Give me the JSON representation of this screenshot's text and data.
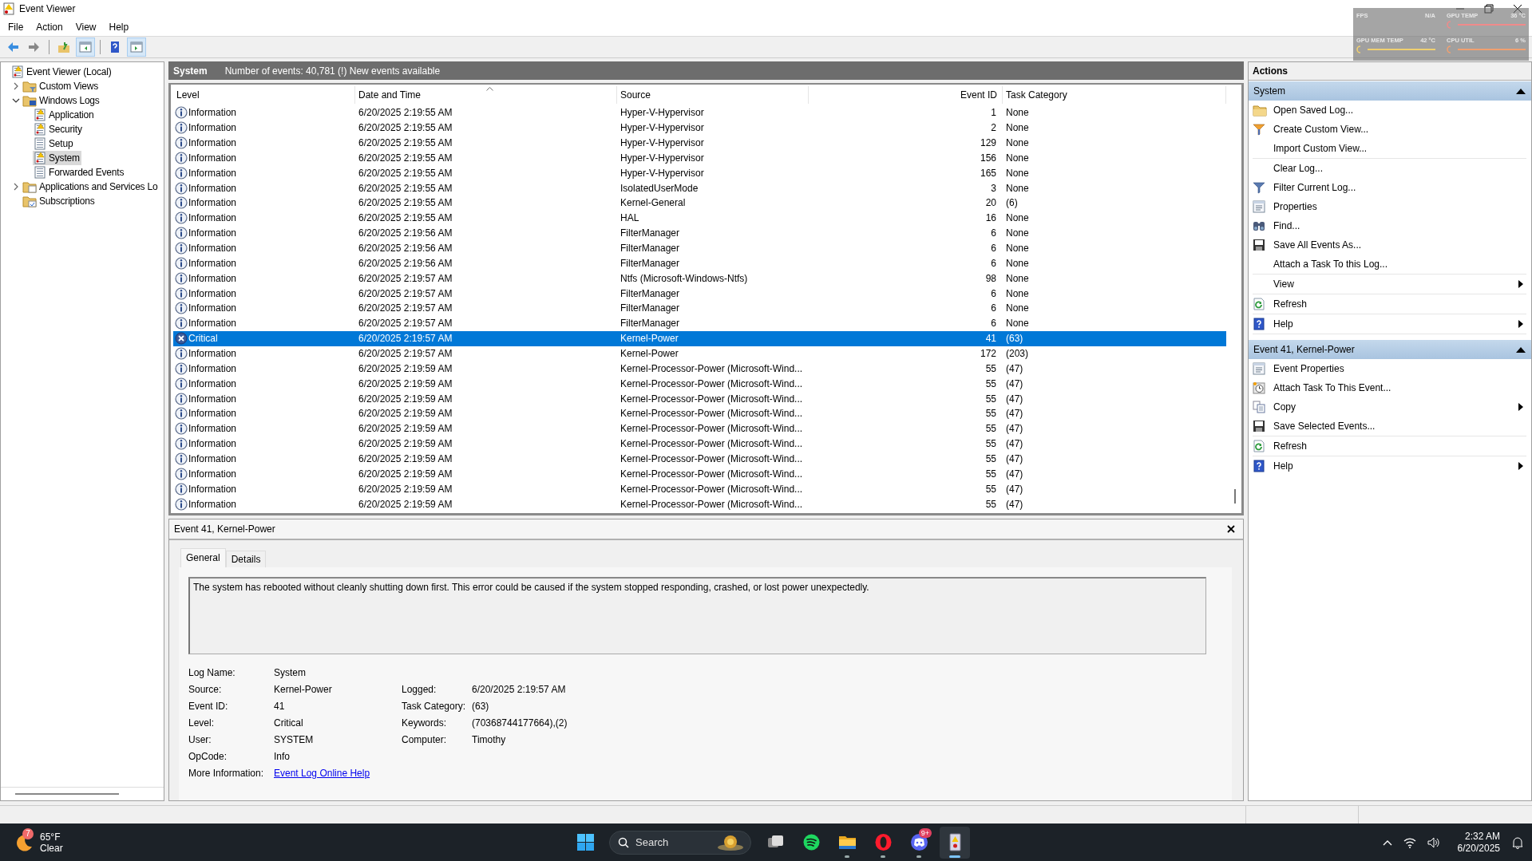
{
  "window": {
    "title": "Event Viewer"
  },
  "menu": [
    "File",
    "Action",
    "View",
    "Help"
  ],
  "toolbar": [
    {
      "kind": "back",
      "on": false
    },
    {
      "kind": "forward",
      "on": false
    },
    {
      "kind": "up",
      "on": false
    },
    {
      "kind": "show-tree",
      "on": true
    },
    {
      "kind": "help",
      "on": false
    },
    {
      "kind": "show-actions",
      "on": true
    }
  ],
  "tree": {
    "items": [
      {
        "label": "Event Viewer (Local)",
        "kind": "root",
        "selected": false,
        "children": [
          {
            "label": "Custom Views",
            "kind": "folder-filter",
            "expanded": false,
            "selected": false
          },
          {
            "label": "Windows Logs",
            "kind": "folder-pc",
            "expanded": true,
            "selected": false,
            "children": [
              {
                "label": "Application",
                "kind": "log-warn",
                "selected": false
              },
              {
                "label": "Security",
                "kind": "log-warn",
                "selected": false
              },
              {
                "label": "Setup",
                "kind": "log",
                "selected": false
              },
              {
                "label": "System",
                "kind": "log-warn",
                "selected": true
              },
              {
                "label": "Forwarded Events",
                "kind": "log",
                "selected": false
              }
            ]
          },
          {
            "label": "Applications and Services Lo",
            "kind": "folder-doc",
            "expanded": false,
            "selected": false
          },
          {
            "label": "Subscriptions",
            "kind": "subscriptions",
            "selected": false
          }
        ]
      }
    ]
  },
  "log_header": {
    "title": "System",
    "summary": "Number of events: 40,781 (!) New events available"
  },
  "table": {
    "columns": [
      {
        "label": "Level",
        "sorted": false
      },
      {
        "label": "Date and Time",
        "sorted": true
      },
      {
        "label": "Source",
        "sorted": false
      },
      {
        "label": "Event ID",
        "sorted": false
      },
      {
        "label": "Task Category",
        "sorted": false
      }
    ],
    "rows": [
      {
        "kind": "info",
        "level": "Information",
        "date": "6/20/2025 2:19:55 AM",
        "source": "Hyper-V-Hypervisor",
        "event_id": "1",
        "category": "None",
        "selected": false
      },
      {
        "kind": "info",
        "level": "Information",
        "date": "6/20/2025 2:19:55 AM",
        "source": "Hyper-V-Hypervisor",
        "event_id": "2",
        "category": "None",
        "selected": false
      },
      {
        "kind": "info",
        "level": "Information",
        "date": "6/20/2025 2:19:55 AM",
        "source": "Hyper-V-Hypervisor",
        "event_id": "129",
        "category": "None",
        "selected": false
      },
      {
        "kind": "info",
        "level": "Information",
        "date": "6/20/2025 2:19:55 AM",
        "source": "Hyper-V-Hypervisor",
        "event_id": "156",
        "category": "None",
        "selected": false
      },
      {
        "kind": "info",
        "level": "Information",
        "date": "6/20/2025 2:19:55 AM",
        "source": "Hyper-V-Hypervisor",
        "event_id": "165",
        "category": "None",
        "selected": false
      },
      {
        "kind": "info",
        "level": "Information",
        "date": "6/20/2025 2:19:55 AM",
        "source": "IsolatedUserMode",
        "event_id": "3",
        "category": "None",
        "selected": false
      },
      {
        "kind": "info",
        "level": "Information",
        "date": "6/20/2025 2:19:55 AM",
        "source": "Kernel-General",
        "event_id": "20",
        "category": "(6)",
        "selected": false
      },
      {
        "kind": "info",
        "level": "Information",
        "date": "6/20/2025 2:19:55 AM",
        "source": "HAL",
        "event_id": "16",
        "category": "None",
        "selected": false
      },
      {
        "kind": "info",
        "level": "Information",
        "date": "6/20/2025 2:19:56 AM",
        "source": "FilterManager",
        "event_id": "6",
        "category": "None",
        "selected": false
      },
      {
        "kind": "info",
        "level": "Information",
        "date": "6/20/2025 2:19:56 AM",
        "source": "FilterManager",
        "event_id": "6",
        "category": "None",
        "selected": false
      },
      {
        "kind": "info",
        "level": "Information",
        "date": "6/20/2025 2:19:56 AM",
        "source": "FilterManager",
        "event_id": "6",
        "category": "None",
        "selected": false
      },
      {
        "kind": "info",
        "level": "Information",
        "date": "6/20/2025 2:19:57 AM",
        "source": "Ntfs (Microsoft-Windows-Ntfs)",
        "event_id": "98",
        "category": "None",
        "selected": false
      },
      {
        "kind": "info",
        "level": "Information",
        "date": "6/20/2025 2:19:57 AM",
        "source": "FilterManager",
        "event_id": "6",
        "category": "None",
        "selected": false
      },
      {
        "kind": "info",
        "level": "Information",
        "date": "6/20/2025 2:19:57 AM",
        "source": "FilterManager",
        "event_id": "6",
        "category": "None",
        "selected": false
      },
      {
        "kind": "info",
        "level": "Information",
        "date": "6/20/2025 2:19:57 AM",
        "source": "FilterManager",
        "event_id": "6",
        "category": "None",
        "selected": false
      },
      {
        "kind": "critical",
        "level": "Critical",
        "date": "6/20/2025 2:19:57 AM",
        "source": "Kernel-Power",
        "event_id": "41",
        "category": "(63)",
        "selected": true
      },
      {
        "kind": "info",
        "level": "Information",
        "date": "6/20/2025 2:19:57 AM",
        "source": "Kernel-Power",
        "event_id": "172",
        "category": "(203)",
        "selected": false
      },
      {
        "kind": "info",
        "level": "Information",
        "date": "6/20/2025 2:19:59 AM",
        "source": "Kernel-Processor-Power (Microsoft-Wind...",
        "event_id": "55",
        "category": "(47)",
        "selected": false
      },
      {
        "kind": "info",
        "level": "Information",
        "date": "6/20/2025 2:19:59 AM",
        "source": "Kernel-Processor-Power (Microsoft-Wind...",
        "event_id": "55",
        "category": "(47)",
        "selected": false
      },
      {
        "kind": "info",
        "level": "Information",
        "date": "6/20/2025 2:19:59 AM",
        "source": "Kernel-Processor-Power (Microsoft-Wind...",
        "event_id": "55",
        "category": "(47)",
        "selected": false
      },
      {
        "kind": "info",
        "level": "Information",
        "date": "6/20/2025 2:19:59 AM",
        "source": "Kernel-Processor-Power (Microsoft-Wind...",
        "event_id": "55",
        "category": "(47)",
        "selected": false
      },
      {
        "kind": "info",
        "level": "Information",
        "date": "6/20/2025 2:19:59 AM",
        "source": "Kernel-Processor-Power (Microsoft-Wind...",
        "event_id": "55",
        "category": "(47)",
        "selected": false
      },
      {
        "kind": "info",
        "level": "Information",
        "date": "6/20/2025 2:19:59 AM",
        "source": "Kernel-Processor-Power (Microsoft-Wind...",
        "event_id": "55",
        "category": "(47)",
        "selected": false
      },
      {
        "kind": "info",
        "level": "Information",
        "date": "6/20/2025 2:19:59 AM",
        "source": "Kernel-Processor-Power (Microsoft-Wind...",
        "event_id": "55",
        "category": "(47)",
        "selected": false
      },
      {
        "kind": "info",
        "level": "Information",
        "date": "6/20/2025 2:19:59 AM",
        "source": "Kernel-Processor-Power (Microsoft-Wind...",
        "event_id": "55",
        "category": "(47)",
        "selected": false
      },
      {
        "kind": "info",
        "level": "Information",
        "date": "6/20/2025 2:19:59 AM",
        "source": "Kernel-Processor-Power (Microsoft-Wind...",
        "event_id": "55",
        "category": "(47)",
        "selected": false
      },
      {
        "kind": "info",
        "level": "Information",
        "date": "6/20/2025 2:19:59 AM",
        "source": "Kernel-Processor-Power (Microsoft-Wind...",
        "event_id": "55",
        "category": "(47)",
        "selected": false
      }
    ]
  },
  "detail": {
    "title": "Event 41, Kernel-Power",
    "tabs": [
      {
        "label": "General",
        "selected": true
      },
      {
        "label": "Details",
        "selected": false
      }
    ],
    "description": "The system has rebooted without cleanly shutting down first. This error could be caused if the system stopped responding, crashed, or lost power unexpectedly.",
    "fields_left": [
      {
        "label": "Log Name:",
        "value": "System"
      },
      {
        "label": "Source:",
        "value": "Kernel-Power"
      },
      {
        "label": "Event ID:",
        "value": "41"
      },
      {
        "label": "Level:",
        "value": "Critical"
      },
      {
        "label": "User:",
        "value": "SYSTEM"
      },
      {
        "label": "OpCode:",
        "value": "Info"
      },
      {
        "label": "More Information:",
        "link": "Event Log Online Help"
      }
    ],
    "fields_right": [
      {
        "label": "Logged:",
        "value": "6/20/2025 2:19:57 AM"
      },
      {
        "label": "Task Category:",
        "value": "(63)"
      },
      {
        "label": "Keywords:",
        "value": "(70368744177664),(2)"
      },
      {
        "label": "Computer:",
        "value": "Timothy"
      }
    ]
  },
  "actions": {
    "title": "Actions",
    "sections": [
      {
        "title": "System",
        "expanded": true,
        "groups": [
          [
            {
              "label": "Open Saved Log...",
              "kind": "folder",
              "submenu": false
            },
            {
              "label": "Create Custom View...",
              "kind": "filter-color",
              "submenu": false
            },
            {
              "label": "Import Custom View...",
              "kind": "plain",
              "submenu": false
            }
          ],
          [
            {
              "label": "Clear Log...",
              "kind": "plain",
              "submenu": false
            },
            {
              "label": "Filter Current Log...",
              "kind": "filter",
              "submenu": false
            },
            {
              "label": "Properties",
              "kind": "properties",
              "submenu": false
            },
            {
              "label": "Find...",
              "kind": "binoculars",
              "submenu": false
            },
            {
              "label": "Save All Events As...",
              "kind": "save",
              "submenu": false
            },
            {
              "label": "Attach a Task To this Log...",
              "kind": "plain",
              "submenu": false
            }
          ],
          [
            {
              "label": "View",
              "kind": "plain",
              "submenu": true
            }
          ],
          [
            {
              "label": "Refresh",
              "kind": "refresh",
              "submenu": false
            }
          ],
          [
            {
              "label": "Help",
              "kind": "help",
              "submenu": true
            }
          ]
        ]
      },
      {
        "title": "Event 41, Kernel-Power",
        "expanded": true,
        "groups": [
          [
            {
              "label": "Event Properties",
              "kind": "properties",
              "submenu": false
            },
            {
              "label": "Attach Task To This Event...",
              "kind": "clock",
              "submenu": false
            },
            {
              "label": "Copy",
              "kind": "copy",
              "submenu": true
            },
            {
              "label": "Save Selected Events...",
              "kind": "save",
              "submenu": false
            }
          ],
          [
            {
              "label": "Refresh",
              "kind": "refresh",
              "submenu": false
            }
          ],
          [
            {
              "label": "Help",
              "kind": "help",
              "submenu": true
            }
          ]
        ]
      }
    ]
  },
  "overlay": {
    "metrics": [
      {
        "kind": "text",
        "label": "FPS",
        "value": "N/A"
      },
      {
        "kind": "gauge",
        "label": "GPU TEMP",
        "value": "36 °C",
        "color": "#f08a8a"
      },
      {
        "kind": "gauge",
        "label": "GPU MEM TEMP",
        "value": "42 °C",
        "color": "#f0d070"
      },
      {
        "kind": "gauge",
        "label": "CPU UTIL",
        "value": "6 %",
        "color": "#f0a070"
      }
    ]
  },
  "taskbar": {
    "weather": {
      "badge": "7",
      "temperature": "65°F",
      "condition": "Clear"
    },
    "search": {
      "placeholder": "Search"
    },
    "apps": [
      {
        "kind": "start",
        "running": false,
        "active": false
      },
      {
        "kind": "task-view",
        "running": false,
        "active": false
      },
      {
        "kind": "spotify",
        "running": false,
        "active": false
      },
      {
        "kind": "files",
        "running": true,
        "active": false
      },
      {
        "kind": "opera",
        "running": true,
        "active": false
      },
      {
        "kind": "discord",
        "running": true,
        "active": false,
        "badge": "9+"
      },
      {
        "kind": "event-viewer",
        "running": true,
        "active": true
      }
    ],
    "clock": {
      "time": "2:32 AM",
      "date": "6/20/2025"
    }
  }
}
